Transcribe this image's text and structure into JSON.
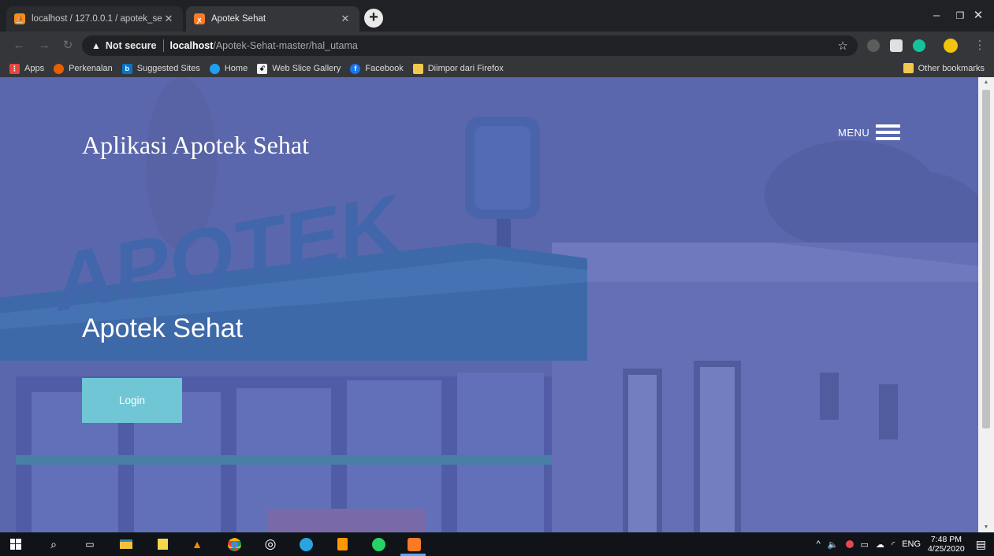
{
  "browser": {
    "tabs": [
      {
        "title": "localhost / 127.0.0.1 / apotek_se",
        "icon": "phpmyadmin-icon",
        "active": false
      },
      {
        "title": "Apotek Sehat",
        "icon": "xampp-icon",
        "active": true
      }
    ],
    "newtab_symbol": "+",
    "controls": {
      "minimize": "–",
      "maximize": "❐",
      "close": "✕"
    },
    "address": {
      "security": "Not secure",
      "host": "localhost",
      "path": "/Apotek-Sehat-master/hal_utama"
    },
    "bookmarks": [
      {
        "label": "Apps",
        "icon": "apps-grid-icon",
        "color": "#e8453c"
      },
      {
        "label": "Perkenalan",
        "icon": "firefox-icon",
        "color": "#e66000"
      },
      {
        "label": "Suggested Sites",
        "icon": "bing-icon",
        "color": "#0a74c9"
      },
      {
        "label": "Home",
        "icon": "bird-icon",
        "color": "#1da1f2"
      },
      {
        "label": "Web Slice Gallery",
        "icon": "web-slice-icon",
        "color": "#3a3a3a"
      },
      {
        "label": "Facebook",
        "icon": "facebook-icon",
        "color": "#1877f2"
      },
      {
        "label": "Diimpor dari Firefox",
        "icon": "folder-icon",
        "color": "#f2c94c"
      }
    ],
    "other_bookmarks": "Other bookmarks"
  },
  "page": {
    "brand": "Aplikasi Apotek Sehat",
    "menu_label": "MENU",
    "hero_title": "Apotek Sehat",
    "login_label": "Login",
    "sign_text": "APOTEK",
    "colors": {
      "accent": "#71c6d6",
      "overlay": "#5d6aab"
    }
  },
  "taskbar": {
    "apps": [
      "windows-start-icon",
      "search-icon",
      "task-view-icon",
      "file-explorer-icon",
      "sticky-notes-icon",
      "vlc-icon",
      "chrome-icon",
      "obs-icon",
      "telegram-icon",
      "sublime-text-icon",
      "whatsapp-icon",
      "xampp-icon"
    ],
    "tray": {
      "language": "ENG",
      "time": "7:48 PM",
      "date": "4/25/2020"
    }
  }
}
